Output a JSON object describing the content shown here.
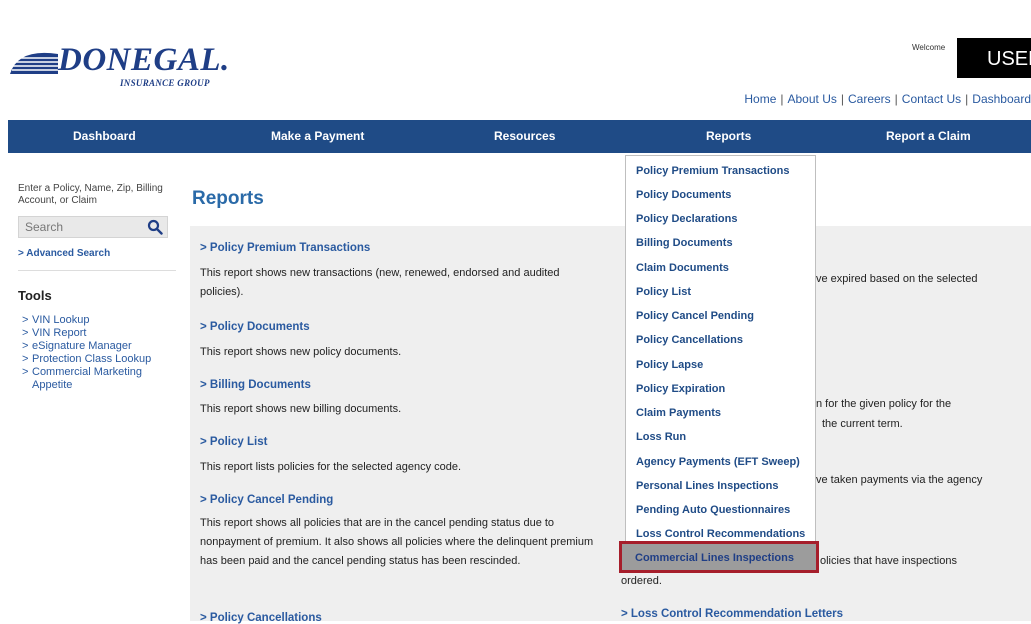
{
  "header": {
    "logo_text": "DONEGAL.",
    "logo_sub": "INSURANCE GROUP",
    "welcome": "Welcome",
    "user_label": "USER",
    "links": [
      "Home",
      "About Us",
      "Careers",
      "Contact Us",
      "Dashboard"
    ],
    "separator": "|"
  },
  "nav": [
    "Dashboard",
    "Make a Payment",
    "Resources",
    "Reports",
    "Report a Claim"
  ],
  "sidebar": {
    "hint": "Enter a Policy, Name, Zip, Billing Account, or Claim",
    "search_placeholder": "Search",
    "advanced_search": "> Advanced Search",
    "tools_heading": "Tools",
    "tools": [
      "VIN Lookup",
      "VIN Report",
      "eSignature Manager",
      "Protection Class Lookup",
      "Commercial Marketing Appetite"
    ]
  },
  "main": {
    "title": "Reports",
    "reports_left": [
      {
        "title": "> Policy Premium Transactions",
        "desc": "This report shows new transactions (new, renewed, endorsed and audited policies)."
      },
      {
        "title": "> Policy Documents",
        "desc": "This report shows new policy documents."
      },
      {
        "title": "> Billing Documents",
        "desc": "This report shows new billing documents."
      },
      {
        "title": "> Policy List",
        "desc": "This report lists policies for the selected agency code."
      },
      {
        "title": "> Policy Cancel Pending",
        "desc": "This report shows all policies that are in the cancel pending status due to nonpayment of premium. It also shows all policies where the delinquent premium has been paid and the cancel pending status has been rescinded."
      },
      {
        "title": "> Policy Cancellations",
        "desc": ""
      }
    ],
    "right_fragments": {
      "frag1": "ve expired based on the selected",
      "frag2a": "n for the given policy for the",
      "frag2b": "the current term.",
      "frag3": "ve taken payments via the agency",
      "frag4": "olicies that have inspections",
      "frag5": "ordered.",
      "frag6": "> Loss Control Recommendation Letters"
    }
  },
  "reports_menu": {
    "items": [
      "Policy Premium Transactions",
      "Policy Documents",
      "Policy Declarations",
      "Billing Documents",
      "Claim Documents",
      "Policy List",
      "Policy Cancel Pending",
      "Policy Cancellations",
      "Policy Lapse",
      "Policy Expiration",
      "Claim Payments",
      "Loss Run",
      "Agency Payments (EFT Sweep)",
      "Personal Lines Inspections",
      "Pending Auto Questionnaires",
      "Loss Control Recommendations"
    ],
    "highlighted": "Commercial Lines Inspections"
  },
  "colors": {
    "nav_bg": "#1f4b86",
    "link": "#2a5aa0",
    "highlight_border": "#a61e2b"
  }
}
